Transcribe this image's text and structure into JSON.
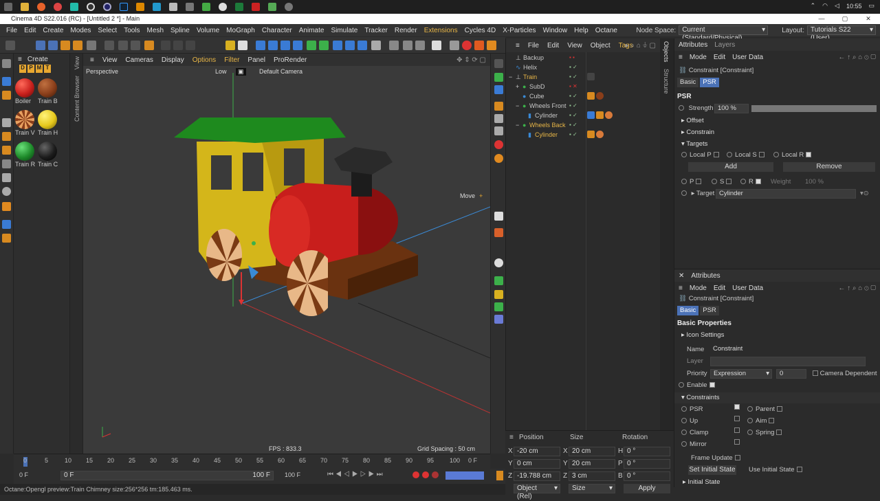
{
  "taskbar": {
    "clock": "10:55"
  },
  "window": {
    "title": "Cinema 4D S22.016 (RC) - [Untitled 2 *] - Main"
  },
  "menu": {
    "items": [
      "File",
      "Edit",
      "Create",
      "Modes",
      "Select",
      "Tools",
      "Mesh",
      "Spline",
      "Volume",
      "MoGraph",
      "Character",
      "Animate",
      "Simulate",
      "Tracker",
      "Render",
      "Extensions",
      "Cycles 4D",
      "X-Particles",
      "Window",
      "Help",
      "Octane"
    ],
    "node_space_label": "Node Space:",
    "node_space_value": "Current (Standard/Physical)",
    "layout_label": "Layout:",
    "layout_value": "Tutorials S22 (User)"
  },
  "materials": {
    "header": "Create",
    "tabs": [
      "D",
      "P",
      "M",
      "T"
    ],
    "items": [
      {
        "name": "Boiler",
        "color": "#c8201c"
      },
      {
        "name": "Train B",
        "color": "#8a3e1a"
      },
      {
        "name": "Train V",
        "color": "#d87a3a"
      },
      {
        "name": "Train H",
        "color": "#e6c81c"
      },
      {
        "name": "Train R",
        "color": "#1e8a2a"
      },
      {
        "name": "Train C",
        "color": "#1c1c1c"
      }
    ]
  },
  "side_tabs": {
    "content_browser": "Content Browser",
    "view": "View",
    "objects": "Objects",
    "structure": "Structure"
  },
  "viewport": {
    "menu": [
      "View",
      "Cameras",
      "Display",
      "Options",
      "Filter",
      "Panel",
      "ProRender"
    ],
    "label": "Perspective",
    "quality": "Low",
    "camera": "Default Camera",
    "move_label": "Move",
    "fps": "FPS : 833.3",
    "grid_spacing": "Grid Spacing : 50 cm"
  },
  "objects": {
    "menu": [
      "File",
      "Edit",
      "View",
      "Object",
      "Tags"
    ],
    "rows": [
      {
        "name": "Backup",
        "indent": 0
      },
      {
        "name": "Helix",
        "indent": 0
      },
      {
        "name": "Train",
        "indent": 0
      },
      {
        "name": "SubD",
        "indent": 1
      },
      {
        "name": "Cube",
        "indent": 1
      },
      {
        "name": "Wheels Front",
        "indent": 1
      },
      {
        "name": "Cylinder",
        "indent": 2
      },
      {
        "name": "Wheels Back",
        "indent": 1
      },
      {
        "name": "Cylinder",
        "indent": 2
      }
    ]
  },
  "attr1": {
    "tabs": [
      "Attributes",
      "Layers"
    ],
    "menu": [
      "Mode",
      "Edit",
      "User Data"
    ],
    "object_title": "Constraint [Constraint]",
    "subtabs": [
      "Basic",
      "PSR"
    ],
    "section": "PSR",
    "strength_label": "Strength",
    "strength_value": "100 %",
    "strength": 1.0,
    "folds": [
      "Offset",
      "Constrain",
      "Targets"
    ],
    "local_p": "Local P",
    "local_s": "Local S",
    "local_r": "Local R",
    "add": "Add",
    "remove": "Remove",
    "p": "P",
    "s": "S",
    "r_label": "R",
    "weight_label": "Weight",
    "weight_value": "100 %",
    "target_label": "Target",
    "target_value": "Cylinder"
  },
  "attr2": {
    "title": "Attributes",
    "menu": [
      "Mode",
      "Edit",
      "User Data"
    ],
    "object_title": "Constraint [Constraint]",
    "subtabs": [
      "Basic",
      "PSR"
    ],
    "section": "Basic Properties",
    "icon_settings": "Icon Settings",
    "name_label": "Name",
    "name_value": "Constraint",
    "layer_label": "Layer",
    "priority_label": "Priority",
    "priority_value": "Expression",
    "priority_num": "0",
    "camera_dependent": "Camera Dependent",
    "enable": "Enable",
    "constraints": "Constraints",
    "psr": "PSR",
    "parent": "Parent",
    "up": "Up",
    "aim": "Aim",
    "clamp": "Clamp",
    "spring": "Spring",
    "mirror": "Mirror",
    "frame_update": "Frame Update",
    "set_initial": "Set Initial State",
    "use_initial": "Use Initial State",
    "initial_state": "Initial State"
  },
  "coords": {
    "headers": [
      "Position",
      "Size",
      "Rotation"
    ],
    "rows": [
      {
        "pl": "X",
        "pv": "-20 cm",
        "sl": "X",
        "sv": "20 cm",
        "rl": "H",
        "rv": "0 °"
      },
      {
        "pl": "Y",
        "pv": "0 cm",
        "sl": "Y",
        "sv": "20 cm",
        "rl": "P",
        "rv": "0 °"
      },
      {
        "pl": "Z",
        "pv": "-19.788 cm",
        "sl": "Z",
        "sv": "3 cm",
        "rl": "B",
        "rv": "0 °"
      }
    ],
    "mode": "Object (Rel)",
    "size_mode": "Size",
    "apply": "Apply"
  },
  "timeline": {
    "ticks": [
      "0",
      "5",
      "10",
      "15",
      "20",
      "25",
      "30",
      "35",
      "40",
      "45",
      "50",
      "55",
      "60",
      "65",
      "70",
      "75",
      "80",
      "85",
      "90",
      "95",
      "100"
    ],
    "end_frame": "0 F",
    "start": "0 F",
    "current": "0 F",
    "end": "100 F",
    "max": "100 F"
  },
  "status": "Octane:Opengl preview:Train Chimney  size:256*256  tm:185.463 ms."
}
